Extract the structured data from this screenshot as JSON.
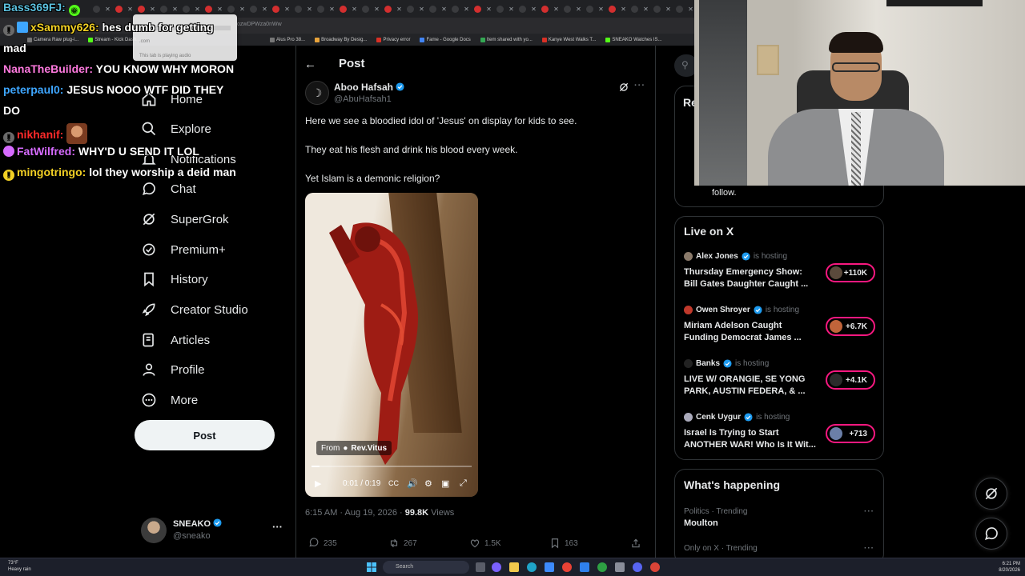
{
  "browser": {
    "url_partial": "ozwDPWza0nWw",
    "bookmarks": [
      "Camera Raw plug-i...",
      "Stream - Kick Dash...",
      "Alus Pro 38...",
      "Broadway By Desig...",
      "Privacy error",
      "Fame - Google Docs",
      "Item shared with yo...",
      "Kanye West Walks T...",
      "SNEAKO Watches IS..."
    ],
    "tab_tooltip": {
      "domain": ".com",
      "audio": "This tab is playing audio"
    }
  },
  "chat": [
    {
      "user": "Bass369FJ:",
      "color": "#5bc0de",
      "message": ""
    },
    {
      "user": "xSammy626:",
      "color": "#f2d024",
      "message": "hes dumb for getting mad"
    },
    {
      "user": "NanaTheBuilder:",
      "color": "#ff7adf",
      "message": "YOU KNOW WHY MORON"
    },
    {
      "user": "peterpaul0:",
      "color": "#3ea6ff",
      "message": "JESUS NOOO WTF DID THEY DO"
    },
    {
      "user": "nikhanif:",
      "color": "#ff2a2a",
      "message": ""
    },
    {
      "user": "FatWilfred:",
      "color": "#d66bff",
      "message": "WHY'D U SEND IT LOL"
    },
    {
      "user": "mingotringo:",
      "color": "#f2d024",
      "message": "lol they worship a deid man"
    }
  ],
  "sidebar": {
    "items": [
      {
        "label": "Home",
        "icon": "home-icon"
      },
      {
        "label": "Explore",
        "icon": "search-icon"
      },
      {
        "label": "Notifications",
        "icon": "bell-icon"
      },
      {
        "label": "Chat",
        "icon": "chat-icon"
      },
      {
        "label": "SuperGrok",
        "icon": "grok-icon"
      },
      {
        "label": "Premium+",
        "icon": "premium-icon"
      },
      {
        "label": "History",
        "icon": "bookmark-icon"
      },
      {
        "label": "Creator Studio",
        "icon": "rocket-icon"
      },
      {
        "label": "Articles",
        "icon": "article-icon"
      },
      {
        "label": "Profile",
        "icon": "person-icon"
      },
      {
        "label": "More",
        "icon": "more-circle-icon"
      }
    ],
    "post_button": "Post",
    "account": {
      "name": "SNEAKO",
      "handle": "@sneako",
      "more": "···"
    }
  },
  "main": {
    "header_title": "Post",
    "tweet": {
      "name": "Aboo Hafsah",
      "handle": "@AbuHafsah1",
      "avatar_glyph": "☽",
      "lines": [
        "Here we see a bloodied idol of 'Jesus' on display for kids to see.",
        "They eat his flesh and drink his blood every week.",
        "Yet Islam is a demonic religion?"
      ],
      "media": {
        "from_label": "From",
        "from_name": "Rev.Vitus",
        "time": "0:01 / 0:19",
        "progress": 0.05
      },
      "meta_time": "6:15 AM · Aug 19, 2026 · ",
      "views_count": "99.8K",
      "views_label": " Views",
      "replies": "235",
      "reposts": "267",
      "likes": "1.5K",
      "bookmarks": "163"
    }
  },
  "right": {
    "relevant_title": "Re",
    "relevant_follow": "follow.",
    "live": {
      "title": "Live on X",
      "hosting_label": "is hosting",
      "items": [
        {
          "host": "Alex Jones",
          "title": "Thursday Emergency Show: Bill Gates Daughter Caught ...",
          "count": "+110K"
        },
        {
          "host": "Owen Shroyer",
          "title": "Miriam Adelson Caught Funding Democrat James ...",
          "count": "+6.7K"
        },
        {
          "host": "Banks",
          "title": "LIVE W/ ORANGIE, SE YONG PARK, AUSTIN FEDERA, & ...",
          "count": "+4.1K"
        },
        {
          "host": "Cenk Uygur",
          "title": "Israel Is Trying to Start ANOTHER WAR! Who Is It Wit...",
          "count": "+713"
        }
      ]
    },
    "happening": {
      "title": "What's happening",
      "trends": [
        {
          "meta": "Politics · Trending",
          "name": "Moulton"
        },
        {
          "meta": "Only on X · Trending",
          "name": ""
        }
      ]
    }
  },
  "taskbar": {
    "weather_temp": "73°F",
    "weather_desc": "Heavy rain",
    "search": "Search",
    "time": "6:21 PM",
    "date": "8/20/2026"
  },
  "colors": {
    "accent": "#1d9bf0",
    "live_pink": "#f91880",
    "background": "#000000"
  }
}
